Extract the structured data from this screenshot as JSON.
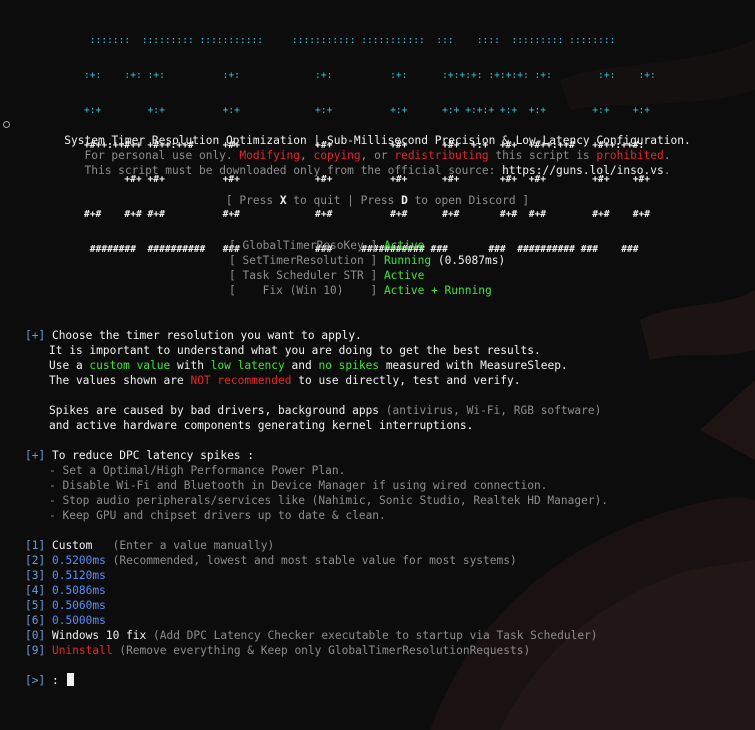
{
  "banner": {
    "ascii_rows": [
      " :::::::  ::::::::: :::::::::::     ::::::::::: :::::::::::  :::    ::::  ::::::::: ::::::::",
      ":+:    :+: :+:          :+:             :+:          :+:      :+:+:+: :+:+:+: :+:        :+:    :+:",
      "+:+        +:+          +:+             +:+          +:+      +:+ +:+:+ +:+  +:+        +:+    +:+",
      "+#++:++#++ +#++:++#     +#+             +#+          +#+      +#+  +:+  +#+  +#++:++#   +#++:++#:",
      "       +#+ +#+          +#+             +#+          +#+      +#+       +#+  +#+        +#+    +#+",
      "#+#    #+# #+#          #+#             #+#          #+#      #+#       #+#  #+#        #+#    #+#",
      " ########  ##########   ###             ###     ########### ###       ###  ########## ###    ###"
    ]
  },
  "header": {
    "title": "System Timer Resolution Optimization | Sub-Millisecond Precision & Low-Latency Configuration.",
    "notice_prefix": "For personal use only. ",
    "notice_modifying": "Modifying",
    "notice_sep1": ", ",
    "notice_copying": "copying",
    "notice_sep2": ", or ",
    "notice_redistributing": "redistributing",
    "notice_middle": " this script is ",
    "notice_prohibited": "prohibited",
    "notice_end": ".",
    "source_prefix": "This script must be downloaded only from the official source: ",
    "source_url": "https://guns.lol/inso.vs",
    "source_end": "."
  },
  "keys": {
    "open": "[ Press ",
    "quit_key": "X",
    "quit_text": " to quit | Press ",
    "discord_key": "D",
    "discord_text": " to open Discord ]"
  },
  "status": [
    {
      "label": "[ GlobalTimerResoKey ]",
      "state": "Active",
      "extra": ""
    },
    {
      "label": "[ SetTimerResolution ]",
      "state": "Running",
      "extra": " (0.5087ms)"
    },
    {
      "label": "[ Task Scheduler STR ]",
      "state": "Active",
      "extra": ""
    },
    {
      "label": "[    Fix (Win 10)    ]",
      "state": "Active + Running",
      "extra": ""
    }
  ],
  "intro": {
    "marker": "[+]",
    "l1": " Choose the timer resolution you want to apply.",
    "l2": "It is important to understand what you are doing to get the best results.",
    "l3_a": "Use a ",
    "l3_custom": "custom value",
    "l3_b": " with ",
    "l3_low": "low latency",
    "l3_c": " and ",
    "l3_spikes": "no spikes",
    "l3_d": " measured with MeasureSleep.",
    "l4_a": "The values shown are ",
    "l4_not": "NOT recommended",
    "l4_b": " to use directly, test and verify.",
    "l5_a": "Spikes are caused by bad drivers, background apps ",
    "l5_b": "(antivirus, Wi-Fi, RGB software)",
    "l6": "and active hardware components generating kernel interruptions."
  },
  "dpc": {
    "marker": "[+]",
    "title": " To reduce DPC latency spikes :",
    "tips": [
      "- Set a Optimal/High Performance Power Plan.",
      "- Disable Wi-Fi and Bluetooth in Device Manager if using wired connection.",
      "- Stop audio peripherals/services like (Nahimic, Sonic Studio, Realtek HD Manager).",
      "- Keep GPU and chipset drivers up to date & clean."
    ]
  },
  "options": [
    {
      "key": "[1]",
      "label": "Custom",
      "desc": "   (Enter a value manually)"
    },
    {
      "key": "[2]",
      "label": "0.5200ms",
      "desc": " (Recommended, lowest and most stable value for most systems)"
    },
    {
      "key": "[3]",
      "label": "0.5120ms",
      "desc": ""
    },
    {
      "key": "[4]",
      "label": "0.5086ms",
      "desc": ""
    },
    {
      "key": "[5]",
      "label": "0.5060ms",
      "desc": ""
    },
    {
      "key": "[6]",
      "label": "0.5000ms",
      "desc": ""
    },
    {
      "key": "[0]",
      "label": "Windows 10 fix",
      "desc": " (Add DPC Latency Checker executable to startup via Task Scheduler)"
    },
    {
      "key": "[9]",
      "label": "Uninstall",
      "desc": " (Remove everything & Keep only GlobalTimerResolutionRequests)"
    }
  ],
  "prompt": {
    "marker": "[>]",
    "colon": " :"
  }
}
